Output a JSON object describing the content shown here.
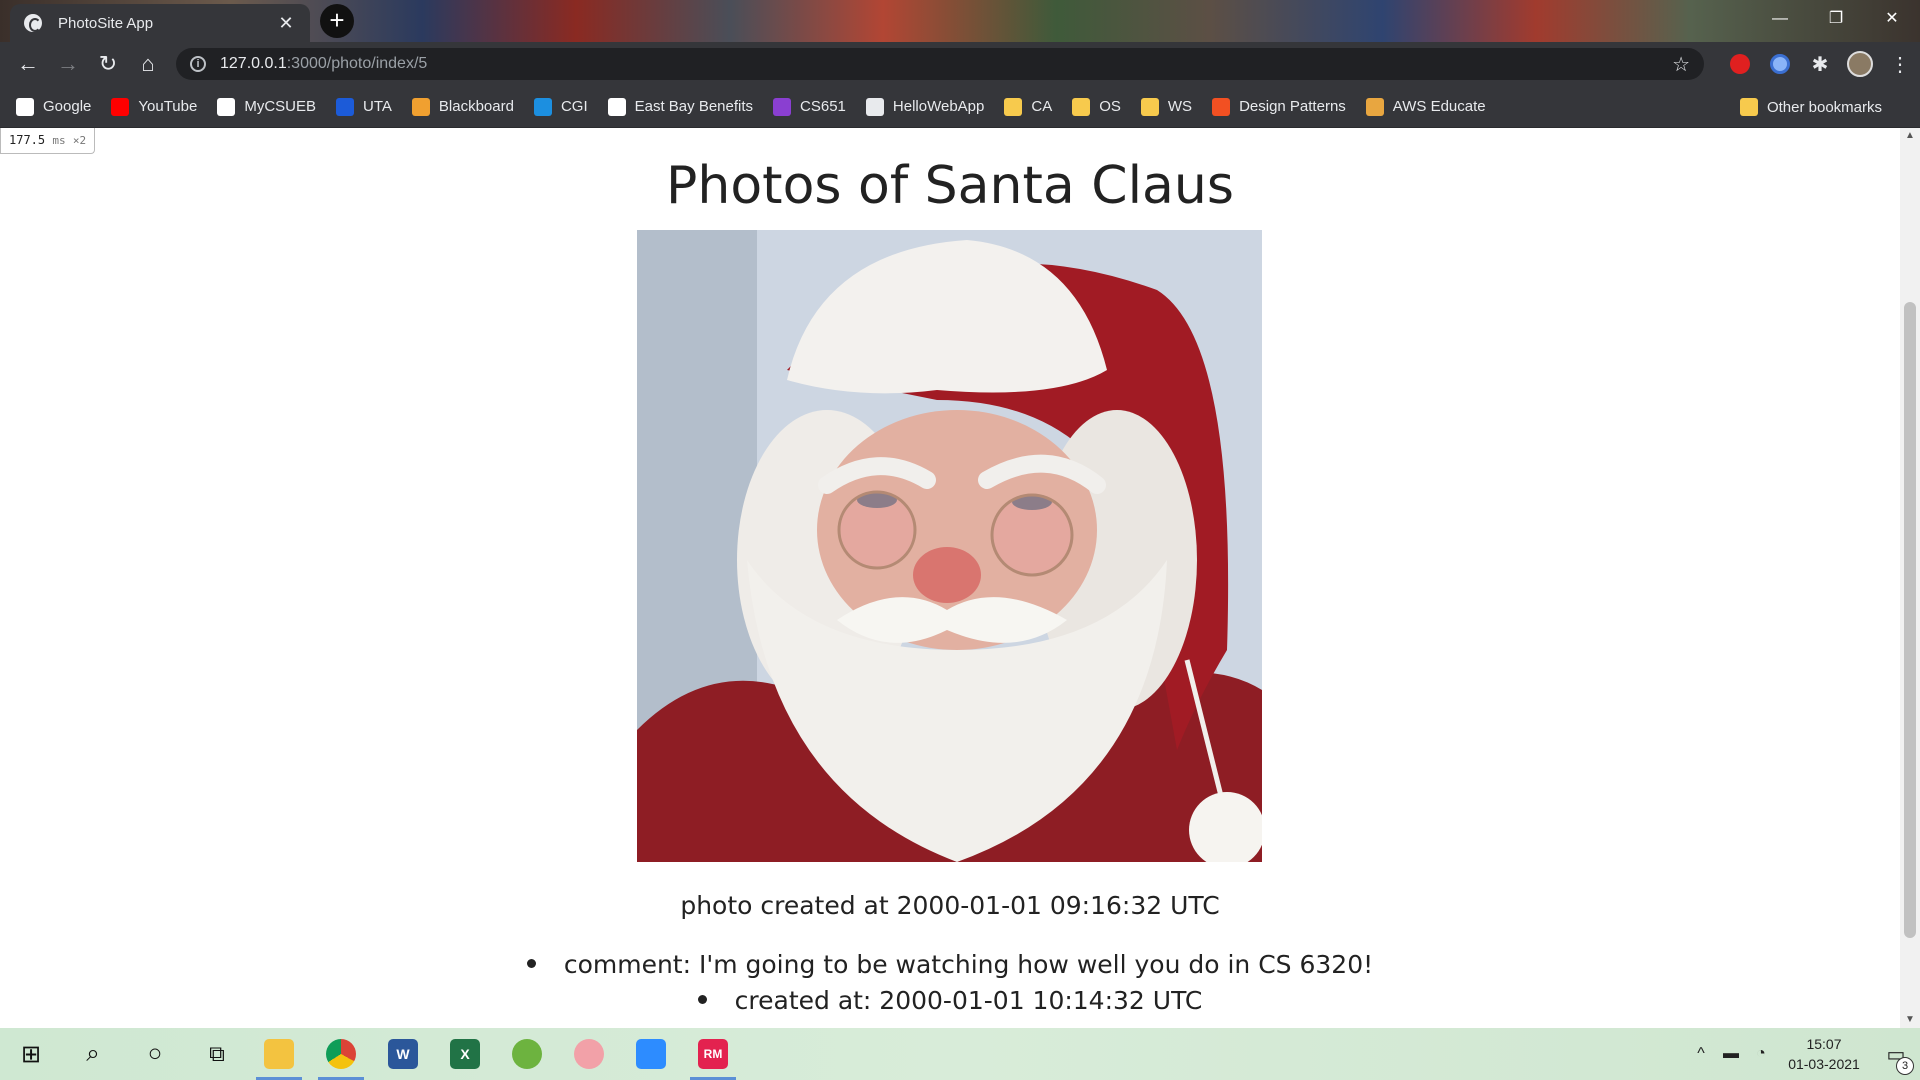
{
  "browser": {
    "tab_title": "PhotoSite App",
    "tab_close": "✕",
    "new_tab": "+",
    "window_controls": {
      "minimize": "—",
      "restore": "❐",
      "close": "✕"
    },
    "url_host": "127.0.0.1",
    "url_path": ":3000/photo/index/5",
    "nav": {
      "back": "←",
      "forward": "→",
      "reload": "↻",
      "home": "⌂"
    },
    "star": "☆"
  },
  "bookmarks": [
    {
      "label": "Google",
      "icon": "google-icon",
      "color": "#ffffff"
    },
    {
      "label": "YouTube",
      "icon": "youtube-icon",
      "color": "#ff0000"
    },
    {
      "label": "MyCSUEB",
      "icon": "mycsueb-icon",
      "color": "#ffffff"
    },
    {
      "label": "UTA",
      "icon": "uta-icon",
      "color": "#1c5bd8"
    },
    {
      "label": "Blackboard",
      "icon": "blackboard-icon",
      "color": "#f0a030"
    },
    {
      "label": "CGI",
      "icon": "cloud-icon",
      "color": "#1c8fe0"
    },
    {
      "label": "East Bay Benefits",
      "icon": "eb-icon",
      "color": "#ffffff"
    },
    {
      "label": "CS651",
      "icon": "cs651-icon",
      "color": "#8a3fd1"
    },
    {
      "label": "HelloWebApp",
      "icon": "globe-icon",
      "color": "#e8eaed"
    },
    {
      "label": "CA",
      "icon": "folder-icon",
      "color": "#f7ca4d"
    },
    {
      "label": "OS",
      "icon": "folder-icon",
      "color": "#f7ca4d"
    },
    {
      "label": "WS",
      "icon": "folder-icon",
      "color": "#f7ca4d"
    },
    {
      "label": "Design Patterns",
      "icon": "microsoft-icon",
      "color": "#f25022"
    },
    {
      "label": "AWS Educate",
      "icon": "aws-icon",
      "color": "#e8a640"
    }
  ],
  "other_bookmarks": "Other bookmarks",
  "perf": {
    "value": "177.5",
    "unit": "ms",
    "mult": "×2"
  },
  "page": {
    "title": "Photos of Santa Claus",
    "photo_created": "photo created at 2000-01-01 09:16:32 UTC",
    "comments": [
      {
        "text": "comment: I'm going to be watching how well you do in CS 6320!"
      },
      {
        "text": "created at: 2000-01-01 10:14:32 UTC"
      }
    ]
  },
  "taskbar": {
    "apps": [
      {
        "name": "start-button",
        "label": "⊞"
      },
      {
        "name": "search-button",
        "label": "⌕"
      },
      {
        "name": "cortana-button",
        "label": "○"
      },
      {
        "name": "task-view-button",
        "label": "⧉"
      },
      {
        "name": "file-explorer-button",
        "label": ""
      },
      {
        "name": "chrome-button",
        "label": ""
      },
      {
        "name": "word-button",
        "label": "W"
      },
      {
        "name": "excel-button",
        "label": "X"
      },
      {
        "name": "spring-button",
        "label": ""
      },
      {
        "name": "snipping-tool-button",
        "label": ""
      },
      {
        "name": "zoom-button",
        "label": ""
      },
      {
        "name": "rubymine-button",
        "label": "RM"
      }
    ],
    "time": "15:07",
    "date": "01-03-2021",
    "notifications": "3"
  }
}
